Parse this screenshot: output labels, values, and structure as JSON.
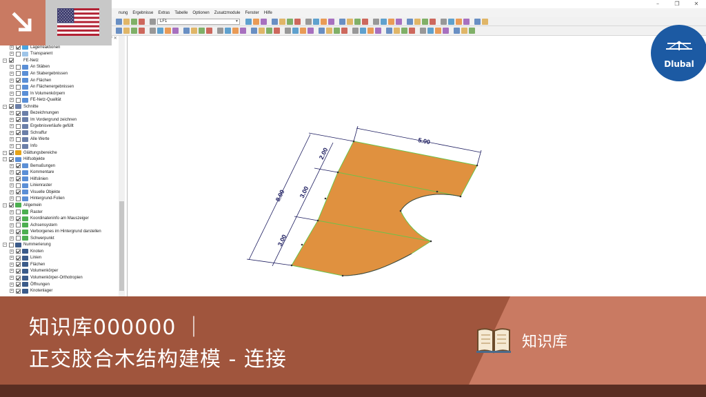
{
  "menu": {
    "items": [
      "nung",
      "Ergebnisse",
      "Extras",
      "Tabelle",
      "Optionen",
      "Zusatzmodule",
      "Fenster",
      "Hilfe"
    ]
  },
  "toolbar": {
    "loadcase_value": "LF1"
  },
  "navigator": {
    "items": [
      {
        "label": "Lagerreaktionen",
        "checked": true,
        "level": 2,
        "icon": "lagerreaktionen-icon"
      },
      {
        "label": "Transparent",
        "checked": false,
        "level": 2,
        "icon": "transparent-icon"
      },
      {
        "label": "FE-Netz",
        "checked": true,
        "level": 1,
        "icon": "none"
      },
      {
        "label": "An Stäben",
        "checked": false,
        "level": 2,
        "icon": "fe-icon"
      },
      {
        "label": "An Stabergebnissen",
        "checked": false,
        "level": 2,
        "icon": "fe-icon"
      },
      {
        "label": "An Flächen",
        "checked": true,
        "level": 2,
        "icon": "fe-icon"
      },
      {
        "label": "An Flächenergebnissen",
        "checked": false,
        "level": 2,
        "icon": "fe-icon"
      },
      {
        "label": "In Volumenkörpern",
        "checked": false,
        "level": 2,
        "icon": "fe-icon"
      },
      {
        "label": "FE-Netz-Qualität",
        "checked": false,
        "level": 2,
        "icon": "fe-icon"
      },
      {
        "label": "Schnitte",
        "checked": true,
        "level": 1,
        "icon": "schnitt-icon"
      },
      {
        "label": "Bezeichnungen",
        "checked": true,
        "level": 2,
        "icon": "schnitt-icon"
      },
      {
        "label": "Im Vordergrund zeichnen",
        "checked": true,
        "level": 2,
        "icon": "schnitt-icon"
      },
      {
        "label": "Ergebnisverläufe gefüllt",
        "checked": false,
        "level": 2,
        "icon": "schnitt-icon"
      },
      {
        "label": "Schraffur",
        "checked": true,
        "level": 2,
        "icon": "schnitt-icon"
      },
      {
        "label": "Alle Werte",
        "checked": false,
        "level": 2,
        "icon": "schnitt-icon"
      },
      {
        "label": "Info",
        "checked": false,
        "level": 2,
        "icon": "schnitt-icon"
      },
      {
        "label": "Glättungsbereiche",
        "checked": true,
        "level": 1,
        "icon": "warn-icon"
      },
      {
        "label": "Hilfsobjekte",
        "checked": true,
        "level": 1,
        "icon": "hilfs-icon"
      },
      {
        "label": "Bemaßungen",
        "checked": true,
        "level": 2,
        "icon": "hilfs-icon"
      },
      {
        "label": "Kommentare",
        "checked": true,
        "level": 2,
        "icon": "hilfs-icon"
      },
      {
        "label": "Hilfslinien",
        "checked": true,
        "level": 2,
        "icon": "hilfs-icon"
      },
      {
        "label": "Linienraster",
        "checked": false,
        "level": 2,
        "icon": "hilfs-icon"
      },
      {
        "label": "Visuelle Objekte",
        "checked": true,
        "level": 2,
        "icon": "hilfs-icon"
      },
      {
        "label": "Hintergrund-Folien",
        "checked": false,
        "level": 2,
        "icon": "hilfs-icon"
      },
      {
        "label": "Allgemein",
        "checked": true,
        "level": 1,
        "icon": "allg-icon"
      },
      {
        "label": "Raster",
        "checked": false,
        "level": 2,
        "icon": "allg-icon"
      },
      {
        "label": "Koordinateninfo am Mauszeiger",
        "checked": true,
        "level": 2,
        "icon": "allg-icon"
      },
      {
        "label": "Achsensystem",
        "checked": false,
        "level": 2,
        "icon": "allg-icon"
      },
      {
        "label": "Verborgenes im Hintergrund darstellen",
        "checked": true,
        "level": 2,
        "icon": "allg-icon"
      },
      {
        "label": "Schwerpunkt",
        "checked": false,
        "level": 2,
        "icon": "allg-icon"
      },
      {
        "label": "Nummerierung",
        "checked": false,
        "level": 1,
        "icon": "num-icon"
      },
      {
        "label": "Knoten",
        "checked": true,
        "level": 2,
        "icon": "num-icon"
      },
      {
        "label": "Linien",
        "checked": true,
        "level": 2,
        "icon": "num-icon"
      },
      {
        "label": "Flächen",
        "checked": true,
        "level": 2,
        "icon": "num-icon"
      },
      {
        "label": "Volumenkörper",
        "checked": true,
        "level": 2,
        "icon": "num-icon"
      },
      {
        "label": "Volumenkörper-Orthotropien",
        "checked": true,
        "level": 2,
        "icon": "num-icon"
      },
      {
        "label": "Öffnungen",
        "checked": true,
        "level": 2,
        "icon": "num-icon"
      },
      {
        "label": "Knotenlager",
        "checked": true,
        "level": 2,
        "icon": "num-icon"
      }
    ]
  },
  "drawing": {
    "dim_top": "5.00",
    "dim_left_total": "8.00",
    "dim_left_a": "2.00",
    "dim_left_b": "3.00",
    "dim_left_c": "3.00",
    "surface_color": "#e0913f",
    "edge_color": "#6cc24a",
    "dim_color": "#1a1a5e"
  },
  "logo": {
    "name": "Dlubal",
    "color": "#1c5aa3"
  },
  "banner": {
    "line1": "知识库000000 ｜",
    "line2": "正交胶合木结构建模 - 连接",
    "kb_label": "知识库",
    "bg_color": "#a0553d",
    "accent_color": "#c97a62"
  }
}
